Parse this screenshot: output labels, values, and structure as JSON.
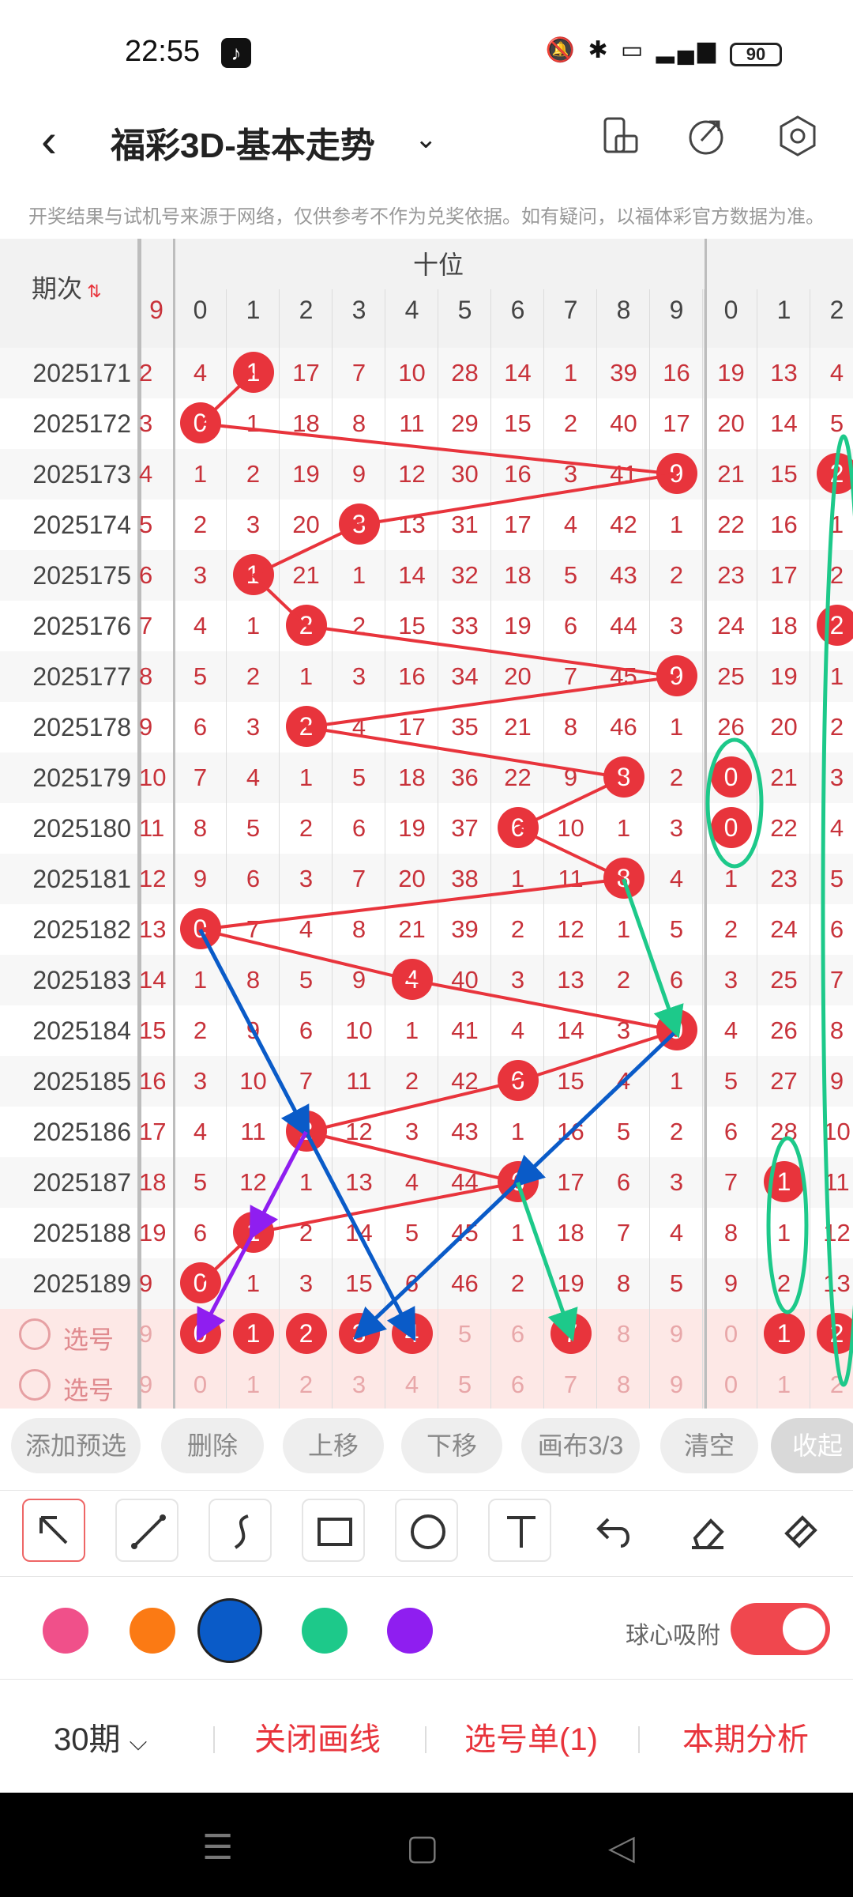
{
  "status": {
    "time": "22:55",
    "app_icon": "tiktok-icon",
    "battery": "90"
  },
  "header": {
    "title": "福彩3D-基本走势"
  },
  "notice": "开奖结果与试机号来源于网络，仅供参考不作为兑奖依据。如有疑问，以福体彩官方数据为准。",
  "table": {
    "period_header": "期次",
    "group_header": "十位",
    "left_col_header": "9",
    "digits": [
      "0",
      "1",
      "2",
      "3",
      "4",
      "5",
      "6",
      "7",
      "8",
      "9"
    ],
    "right_digits": [
      "0",
      "1",
      "2"
    ],
    "rows": [
      {
        "p": "2025171",
        "left": "2",
        "main": [
          "4",
          "1",
          "17",
          "7",
          "10",
          "28",
          "14",
          "1",
          "39",
          "16"
        ],
        "right": [
          "19",
          "13",
          "4"
        ],
        "hit": 1,
        "rhit": null
      },
      {
        "p": "2025172",
        "left": "3",
        "main": [
          "0",
          "1",
          "18",
          "8",
          "11",
          "29",
          "15",
          "2",
          "40",
          "17"
        ],
        "right": [
          "20",
          "14",
          "5"
        ],
        "hit": 0,
        "rhit": null
      },
      {
        "p": "2025173",
        "left": "4",
        "main": [
          "1",
          "2",
          "19",
          "9",
          "12",
          "30",
          "16",
          "3",
          "41",
          "9"
        ],
        "right": [
          "21",
          "15",
          "2"
        ],
        "hit": 9,
        "rhit": 2
      },
      {
        "p": "2025174",
        "left": "5",
        "main": [
          "2",
          "3",
          "20",
          "3",
          "13",
          "31",
          "17",
          "4",
          "42",
          "1"
        ],
        "right": [
          "22",
          "16",
          "1"
        ],
        "hit": 3,
        "rhit": null
      },
      {
        "p": "2025175",
        "left": "6",
        "main": [
          "3",
          "1",
          "21",
          "1",
          "14",
          "32",
          "18",
          "5",
          "43",
          "2"
        ],
        "right": [
          "23",
          "17",
          "2"
        ],
        "hit": 1,
        "rhit": null
      },
      {
        "p": "2025176",
        "left": "7",
        "main": [
          "4",
          "1",
          "2",
          "2",
          "15",
          "33",
          "19",
          "6",
          "44",
          "3"
        ],
        "right": [
          "24",
          "18",
          "2"
        ],
        "hit": 2,
        "rhit": 2
      },
      {
        "p": "2025177",
        "left": "8",
        "main": [
          "5",
          "2",
          "1",
          "3",
          "16",
          "34",
          "20",
          "7",
          "45",
          "9"
        ],
        "right": [
          "25",
          "19",
          "1"
        ],
        "hit": 9,
        "rhit": null
      },
      {
        "p": "2025178",
        "left": "9",
        "main": [
          "6",
          "3",
          "2",
          "4",
          "17",
          "35",
          "21",
          "8",
          "46",
          "1"
        ],
        "right": [
          "26",
          "20",
          "2"
        ],
        "hit": 2,
        "rhit": null
      },
      {
        "p": "2025179",
        "left": "10",
        "main": [
          "7",
          "4",
          "1",
          "5",
          "18",
          "36",
          "22",
          "9",
          "8",
          "2"
        ],
        "right": [
          "0",
          "21",
          "3"
        ],
        "hit": 8,
        "rhit": 0
      },
      {
        "p": "2025180",
        "left": "11",
        "main": [
          "8",
          "5",
          "2",
          "6",
          "19",
          "37",
          "6",
          "10",
          "1",
          "3"
        ],
        "right": [
          "0",
          "22",
          "4"
        ],
        "hit": 6,
        "rhit": 0
      },
      {
        "p": "2025181",
        "left": "12",
        "main": [
          "9",
          "6",
          "3",
          "7",
          "20",
          "38",
          "1",
          "11",
          "8",
          "4"
        ],
        "right": [
          "1",
          "23",
          "5"
        ],
        "hit": 8,
        "rhit": null
      },
      {
        "p": "2025182",
        "left": "13",
        "main": [
          "0",
          "7",
          "4",
          "8",
          "21",
          "39",
          "2",
          "12",
          "1",
          "5"
        ],
        "right": [
          "2",
          "24",
          "6"
        ],
        "hit": 0,
        "rhit": null
      },
      {
        "p": "2025183",
        "left": "14",
        "main": [
          "1",
          "8",
          "5",
          "9",
          "4",
          "40",
          "3",
          "13",
          "2",
          "6"
        ],
        "right": [
          "3",
          "25",
          "7"
        ],
        "hit": 4,
        "rhit": null
      },
      {
        "p": "2025184",
        "left": "15",
        "main": [
          "2",
          "9",
          "6",
          "10",
          "1",
          "41",
          "4",
          "14",
          "3",
          "9"
        ],
        "right": [
          "4",
          "26",
          "8"
        ],
        "hit": 9,
        "rhit": null
      },
      {
        "p": "2025185",
        "left": "16",
        "main": [
          "3",
          "10",
          "7",
          "11",
          "2",
          "42",
          "6",
          "15",
          "4",
          "1"
        ],
        "right": [
          "5",
          "27",
          "9"
        ],
        "hit": 6,
        "rhit": null
      },
      {
        "p": "2025186",
        "left": "17",
        "main": [
          "4",
          "11",
          "2",
          "12",
          "3",
          "43",
          "1",
          "16",
          "5",
          "2"
        ],
        "right": [
          "6",
          "28",
          "10"
        ],
        "hit": 2,
        "rhit": null
      },
      {
        "p": "2025187",
        "left": "18",
        "main": [
          "5",
          "12",
          "1",
          "13",
          "4",
          "44",
          "6",
          "17",
          "6",
          "3"
        ],
        "right": [
          "7",
          "1",
          "11"
        ],
        "hit": 6,
        "rhit": 1
      },
      {
        "p": "2025188",
        "left": "19",
        "main": [
          "6",
          "1",
          "2",
          "14",
          "5",
          "45",
          "1",
          "18",
          "7",
          "4"
        ],
        "right": [
          "8",
          "1",
          "12"
        ],
        "hit": 1,
        "rhit": null
      },
      {
        "p": "2025189",
        "left": "9",
        "main": [
          "0",
          "1",
          "3",
          "15",
          "6",
          "46",
          "2",
          "19",
          "8",
          "5"
        ],
        "right": [
          "9",
          "2",
          "13"
        ],
        "hit": 0,
        "rhit": null
      }
    ],
    "select_label": "选号",
    "select_row_1_balls": [
      0,
      1,
      2,
      3,
      4,
      7
    ],
    "select_row_1_right_balls": [
      1,
      2
    ]
  },
  "actions": [
    "添加预选",
    "删除",
    "上移",
    "下移",
    "画布3/3",
    "清空",
    "收起"
  ],
  "tools": [
    "arrow-tool-icon",
    "line-tool-icon",
    "curve-tool-icon",
    "rectangle-tool-icon",
    "circle-tool-icon",
    "text-tool-icon",
    "undo-icon",
    "eraser-icon",
    "clear-brush-icon"
  ],
  "colors": [
    "#f0508a",
    "#fb7a14",
    "#0a5bc8",
    "#1dc98a",
    "#8f1ef0"
  ],
  "selected_color": "#0a5bc8",
  "snap": {
    "label": "球心吸附",
    "on": true
  },
  "bottom": {
    "periods": "30期",
    "close_lines": "关闭画线",
    "selection_list": "选号单(1)",
    "analysis": "本期分析"
  }
}
